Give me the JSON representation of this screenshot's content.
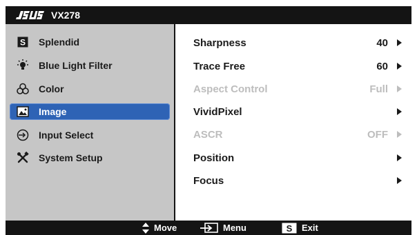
{
  "header": {
    "brand": "ASUS",
    "model": "VX278"
  },
  "sidebar": {
    "items": [
      {
        "label": "Splendid",
        "icon": "splendid-s-icon"
      },
      {
        "label": "Blue Light Filter",
        "icon": "light-bulb-icon"
      },
      {
        "label": "Color",
        "icon": "color-circles-icon"
      },
      {
        "label": "Image",
        "icon": "image-icon",
        "active": true
      },
      {
        "label": "Input Select",
        "icon": "input-select-icon"
      },
      {
        "label": "System Setup",
        "icon": "tools-icon"
      }
    ]
  },
  "options": [
    {
      "label": "Sharpness",
      "value": "40",
      "enabled": true
    },
    {
      "label": "Trace Free",
      "value": "60",
      "enabled": true
    },
    {
      "label": "Aspect Control",
      "value": "Full",
      "enabled": false
    },
    {
      "label": "VividPixel",
      "value": "",
      "enabled": true
    },
    {
      "label": "ASCR",
      "value": "OFF",
      "enabled": false
    },
    {
      "label": "Position",
      "value": "",
      "enabled": true
    },
    {
      "label": "Focus",
      "value": "",
      "enabled": true
    }
  ],
  "footer": {
    "move": "Move",
    "menu": "Menu",
    "exit_key": "S",
    "exit": "Exit"
  },
  "colors": {
    "active": "#2e63b5",
    "bar": "#141414",
    "sidebar": "#c6c6c6",
    "disabled": "#bdbdbd"
  }
}
